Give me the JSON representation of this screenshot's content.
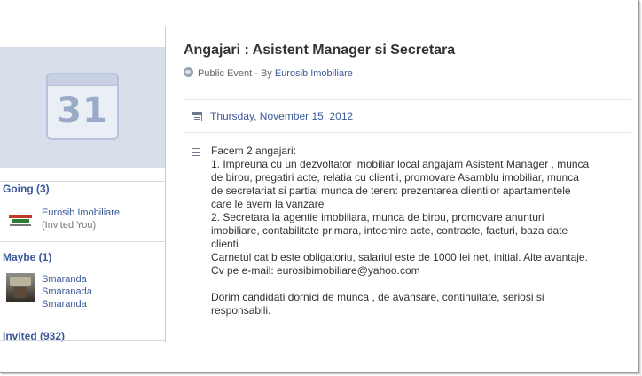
{
  "calendar": {
    "day": "31"
  },
  "going": {
    "heading": "Going (3)",
    "people": [
      {
        "name": "Eurosib Imobiliare",
        "note": "(Invited You)"
      }
    ]
  },
  "maybe": {
    "heading": "Maybe (1)",
    "names": [
      "Smaranda",
      "Smaranada",
      "Smaranda"
    ]
  },
  "invited": {
    "heading": "Invited (932)"
  },
  "event": {
    "title": "Angajari : Asistent Manager si Secretara",
    "privacy": "Public Event",
    "by_prefix": "· By",
    "host": "Eurosib Imobiliare",
    "date": "Thursday, November 15, 2012",
    "description": [
      "Facem 2 angajari:",
      "1. Impreuna cu un dezvoltator imobiliar local angajam Asistent Manager , munca",
      "de birou, pregatiri acte, relatia cu clientii, promovare Asamblu imobiliar, munca",
      "de secretariat si partial munca de teren: prezentarea clientilor apartamentele",
      "care le avem la vanzare",
      "2. Secretara la agentie imobiliara, munca de birou, promovare anunturi",
      "imobiliare, contabilitate primara, intocmire acte, contracte, facturi, baza date",
      "clienti",
      "Carnetul cat b este obligatoriu, salariul este de 1000 lei net, initial. Alte avantaje.",
      "Cv pe e-mail: eurosibimobiliare@yahoo.com",
      "",
      "Dorim candidati dornici de munca , de avansare, continuitate, seriosi si",
      "responsabili."
    ]
  },
  "icons": {
    "calendar": "calendar-icon",
    "globe": "globe-icon",
    "date": "calendar-small-icon",
    "description": "text-lines-icon"
  }
}
